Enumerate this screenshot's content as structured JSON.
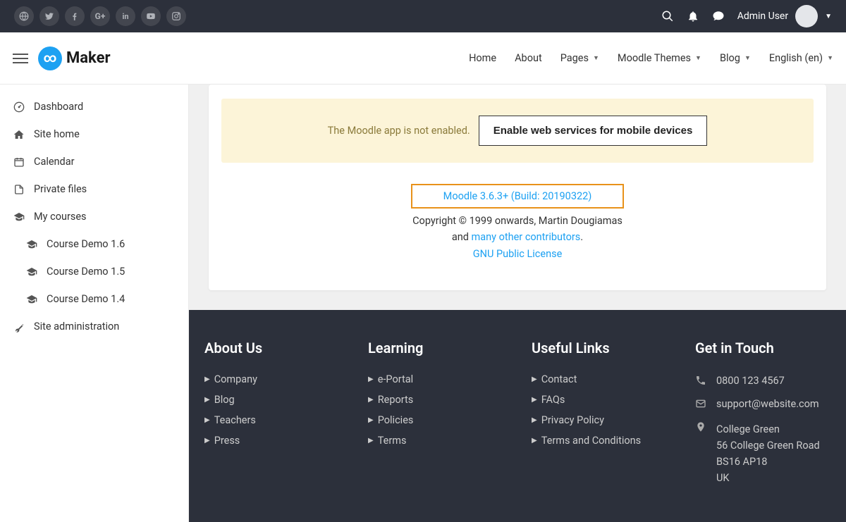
{
  "topbar": {
    "social": [
      "globe",
      "twitter",
      "facebook",
      "googleplus",
      "linkedin",
      "youtube",
      "instagram"
    ],
    "user_label": "Admin User"
  },
  "navbar": {
    "logo_text": "Maker",
    "items": [
      {
        "label": "Home",
        "dropdown": false
      },
      {
        "label": "About",
        "dropdown": false
      },
      {
        "label": "Pages",
        "dropdown": true
      },
      {
        "label": "Moodle Themes",
        "dropdown": true
      },
      {
        "label": "Blog",
        "dropdown": true
      },
      {
        "label": "English (en)",
        "dropdown": true
      }
    ]
  },
  "sidebar": {
    "items": [
      {
        "icon": "dashboard",
        "label": "Dashboard"
      },
      {
        "icon": "home",
        "label": "Site home"
      },
      {
        "icon": "calendar",
        "label": "Calendar"
      },
      {
        "icon": "file",
        "label": "Private files"
      },
      {
        "icon": "graduation",
        "label": "My courses"
      }
    ],
    "courses": [
      {
        "label": "Course Demo 1.6"
      },
      {
        "label": "Course Demo 1.5"
      },
      {
        "label": "Course Demo 1.4"
      }
    ],
    "admin_label": "Site administration"
  },
  "content": {
    "alert_text": "The Moodle app is not enabled.",
    "alert_button": "Enable web services for mobile devices",
    "version_link": "Moodle 3.6.3+ (Build: 20190322)",
    "copyright_line": "Copyright © 1999 onwards, Martin Dougiamas",
    "contributors_prefix": "and ",
    "contributors_link": "many other contributors",
    "license_link": "GNU Public License"
  },
  "footer": {
    "cols": [
      {
        "title": "About Us",
        "links": [
          "Company",
          "Blog",
          "Teachers",
          "Press"
        ]
      },
      {
        "title": "Learning",
        "links": [
          "e-Portal",
          "Reports",
          "Policies",
          "Terms"
        ]
      },
      {
        "title": "Useful Links",
        "links": [
          "Contact",
          "FAQs",
          "Privacy Policy",
          "Terms and Conditions"
        ]
      }
    ],
    "contact_title": "Get in Touch",
    "phone": "0800 123 4567",
    "email": "support@website.com",
    "address": [
      "College Green",
      "56 College Green Road",
      "BS16 AP18",
      "UK"
    ]
  }
}
